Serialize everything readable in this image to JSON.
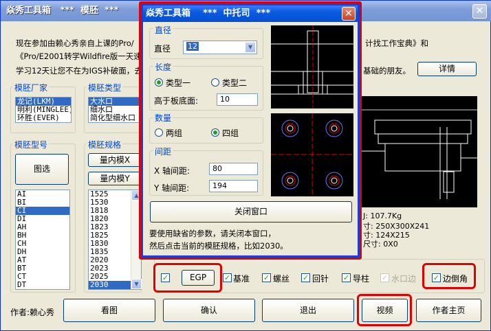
{
  "main": {
    "title": "焱秀工具箱   ***  模胚  ***",
    "intro": {
      "line1": "现在参加由赖心秀亲自上课的Pro/",
      "line1_right": "计找工作宝典》和",
      "line2": "《Pro/E2001转学Wildfire版一天速",
      "line3": "学习12天让您不在为IGS补破面，去",
      "line3_right": "基础的朋友。",
      "details_btn": "详情"
    },
    "groups": {
      "vendor": "模胚厂家",
      "type": "模胚类型",
      "model": "模胚型号",
      "spec": "模胚规格"
    },
    "vendors": [
      "龙记(LKM)",
      "明利(MINGLEE)",
      "环胜(EVER)"
    ],
    "types": [
      "大水口",
      "细水口",
      "简化型细水口"
    ],
    "filter_btn": "图选",
    "spec_btn_x": "量内模X",
    "spec_btn_y": "量内模Y",
    "models": [
      "AI",
      "BI",
      "CI",
      "DI",
      "AH",
      "BH",
      "CH",
      "DH",
      "AT",
      "BT",
      "CT",
      "DT"
    ],
    "models_selected": "CI",
    "specs": [
      "1525",
      "1530",
      "1818",
      "1820",
      "1823",
      "1825",
      "1830",
      "1835",
      "2020",
      "2023",
      "2025",
      "2030"
    ],
    "specs_selected": "2030",
    "info": {
      "weight": "J: 107.7Kg",
      "size": "寸: 250X300X241",
      "inner": "寸: 124X215",
      "offset": "尺寸: 0X0"
    },
    "options": {
      "egp_btn": "EGP",
      "datum": "基准",
      "screw": "螺丝",
      "return_pin": "回针",
      "guide_pin": "导柱",
      "gate_edge": "水口边",
      "chamfer": "边倒角"
    },
    "author_label": "作者:赖心秀",
    "buttons": {
      "view": "看图",
      "confirm": "确认",
      "exit": "退出",
      "video": "视频",
      "home": "作者主页"
    }
  },
  "dialog": {
    "title": "焱秀工具箱    ***  中托司  ***",
    "diameter_group": "直径",
    "diameter_label": "直径",
    "diameter_value": "12",
    "length_group": "长度",
    "type1": "类型一",
    "type2": "类型二",
    "height_label": "高于板底面:",
    "height_value": "10",
    "count_group": "数量",
    "two": "两组",
    "four": "四组",
    "spacing_group": "间距",
    "x_label": "X 轴间距:",
    "x_value": "80",
    "y_label": "Y 轴间距:",
    "y_value": "194",
    "close_btn": "关闭窗口",
    "hint1": "要使用缺省的参数，请关闭本窗口，",
    "hint2": "然后点击当前的模胚规格，比如2030。"
  },
  "colors": {
    "title_bar": "#0a5ae0",
    "highlight": "#e00000",
    "selection": "#316ac5",
    "check_green": "#21a121"
  }
}
